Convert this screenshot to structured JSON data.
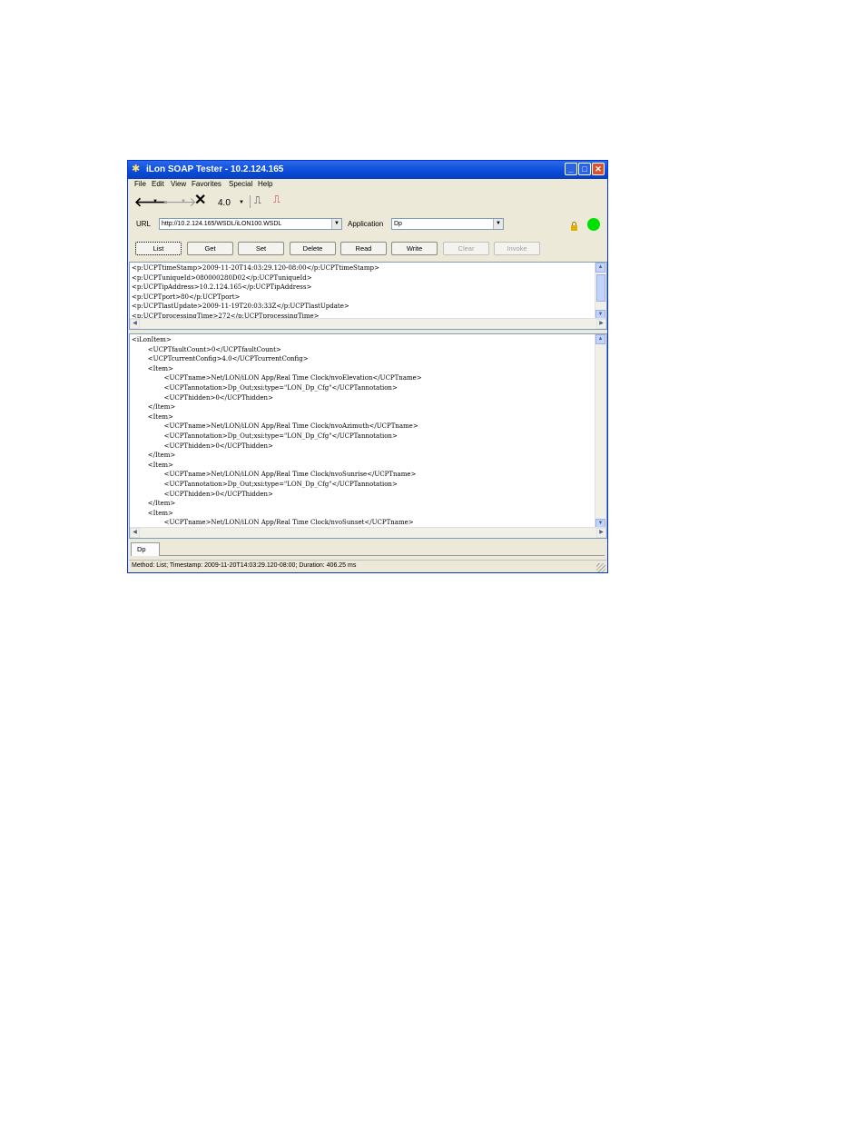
{
  "window": {
    "title": "iLon SOAP Tester - 10.2.124.165"
  },
  "menu": [
    "File",
    "Edit",
    "View",
    "Favorites",
    "Special",
    "Help"
  ],
  "toolbar": {
    "version": "4.0"
  },
  "url_row": {
    "url_label": "URL",
    "url_value": "http://10.2.124.165/WSDL/iLON100.WSDL",
    "application_label": "Application",
    "application_value": "Dp"
  },
  "buttons": [
    {
      "label": "List",
      "enabled": true,
      "focused": true
    },
    {
      "label": "Get",
      "enabled": true
    },
    {
      "label": "Set",
      "enabled": true
    },
    {
      "label": "Delete",
      "enabled": true
    },
    {
      "label": "Read",
      "enabled": true
    },
    {
      "label": "Write",
      "enabled": true
    },
    {
      "label": "Clear",
      "enabled": false
    },
    {
      "label": "Invoke",
      "enabled": false
    }
  ],
  "response_header_text": "<p:UCPTtimeStamp>2009-11-20T14:03:29.120-08:00</p:UCPTtimeStamp>\n<p:UCPTuniqueId>080000280D02</p:UCPTuniqueId>\n<p:UCPTipAddress>10.2.124.165</p:UCPTipAddress>\n<p:UCPTport>80</p:UCPTport>\n<p:UCPTlastUpdate>2009-11-19T20:03:33Z</p:UCPTlastUpdate>\n<p:UCPTprocessingTime>272</p:UCPTprocessingTime>",
  "response_body_text": "<iLonItem>\n        <UCPTfaultCount>0</UCPTfaultCount>\n        <UCPTcurrentConfig>4.0</UCPTcurrentConfig>\n        <Item>\n                <UCPTname>Net/LON/iLON App/Real Time Clock/nvoElevation</UCPTname>\n                <UCPTannotation>Dp_Out;xsi:type=\"LON_Dp_Cfg\"</UCPTannotation>\n                <UCPThidden>0</UCPThidden>\n        </Item>\n        <Item>\n                <UCPTname>Net/LON/iLON App/Real Time Clock/nvoAzimuth</UCPTname>\n                <UCPTannotation>Dp_Out;xsi:type=\"LON_Dp_Cfg\"</UCPTannotation>\n                <UCPThidden>0</UCPThidden>\n        </Item>\n        <Item>\n                <UCPTname>Net/LON/iLON App/Real Time Clock/nvoSunrise</UCPTname>\n                <UCPTannotation>Dp_Out;xsi:type=\"LON_Dp_Cfg\"</UCPTannotation>\n                <UCPThidden>0</UCPThidden>\n        </Item>\n        <Item>\n                <UCPTname>Net/LON/iLON App/Real Time Clock/nvoSunset</UCPTname>",
  "tab": {
    "label": "Dp"
  },
  "status": {
    "text": "Method: List; Timestamp: 2009-11-20T14:03:29.120-08:00; Duration: 406.25 ms"
  },
  "colors": {
    "connection_indicator": "#00e000",
    "lock_icon": "#e0b000"
  }
}
